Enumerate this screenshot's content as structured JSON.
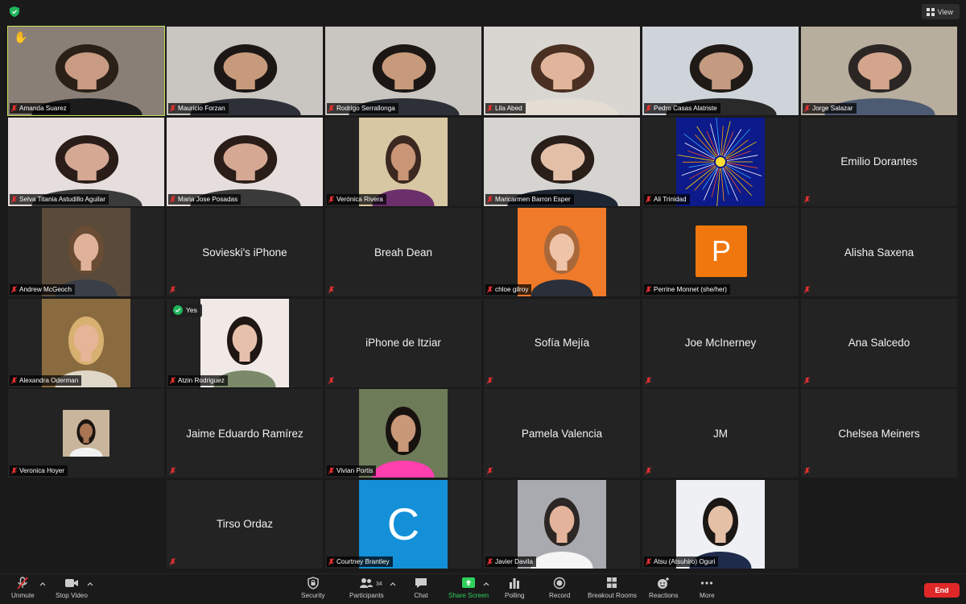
{
  "app": {
    "view_label": "View"
  },
  "tiles": [
    {
      "name": "Amanda Suarez",
      "video": "woman-curly-glasses",
      "hand": "✋"
    },
    {
      "name": "Mauricio Forzan",
      "video": "man-suit"
    },
    {
      "name": "Rodrigo Serrallonga",
      "video": "man-suit"
    },
    {
      "name": "Lila Abed",
      "video": "woman-smile"
    },
    {
      "name": "Pedro Casas Alatriste",
      "video": "man-glasses"
    },
    {
      "name": "Jorge Salazar",
      "video": "man-suit-office"
    },
    {
      "name": "Selva Titania Astudillo Aguilar",
      "video": "woman-glasses"
    },
    {
      "name": "Maria Jose Posadas",
      "video": "woman-glasses"
    },
    {
      "name": "Verónica Rivera",
      "video": "woman-purple"
    },
    {
      "name": "Maricarmen Barron Esper",
      "video": "woman-thinking"
    },
    {
      "name": "Ali Trinidad",
      "video": "particle-collision"
    },
    {
      "name": "Emilio Dorantes"
    },
    {
      "name": "Andrew McGeoch",
      "video": "man-glasses-suit"
    },
    {
      "name": "Sovieski's iPhone"
    },
    {
      "name": "Breah Dean"
    },
    {
      "name": "chloe gilroy",
      "video": "woman-orange-bg"
    },
    {
      "name": "Perrine Monnet (she/her)",
      "avatar": "P"
    },
    {
      "name": "Alisha Saxena"
    },
    {
      "name": "Alexandra Oderman",
      "video": "woman-blonde"
    },
    {
      "name": "Atzin Rodriguez",
      "video": "woman-dark-hair",
      "badge": "Yes"
    },
    {
      "name": "iPhone de Itziar"
    },
    {
      "name": "Sofía Mejía"
    },
    {
      "name": "Joe McInerney"
    },
    {
      "name": "Ana Salcedo"
    },
    {
      "name": "Veronica Hoyer",
      "video": "woman-small"
    },
    {
      "name": "Jaime Eduardo Ramírez"
    },
    {
      "name": "Vivian Portis",
      "video": "woman-pink"
    },
    {
      "name": "Pamela Valencia"
    },
    {
      "name": "JM"
    },
    {
      "name": "Chelsea Meiners"
    },
    {
      "name": "Tirso Ordaz"
    },
    {
      "name": "Courtney Brantley",
      "avatar": "C"
    },
    {
      "name": "Javier Davila",
      "video": "man-glasses-white"
    },
    {
      "name": "Atsu (Atsuhiro) Oguri",
      "video": "man-navy-suit"
    }
  ],
  "toolbar": {
    "unmute": "Unmute",
    "stop_video": "Stop Video",
    "security": "Security",
    "participants": "Participants",
    "participants_count": "34",
    "chat": "Chat",
    "share_screen": "Share Screen",
    "polling": "Polling",
    "record": "Record",
    "breakout_rooms": "Breakout Rooms",
    "reactions": "Reactions",
    "more": "More",
    "end": "End"
  },
  "colors": {
    "active_speaker": "#c5e05a",
    "end": "#e02828",
    "share": "#2fd05b",
    "mic_off": "#e03030"
  }
}
